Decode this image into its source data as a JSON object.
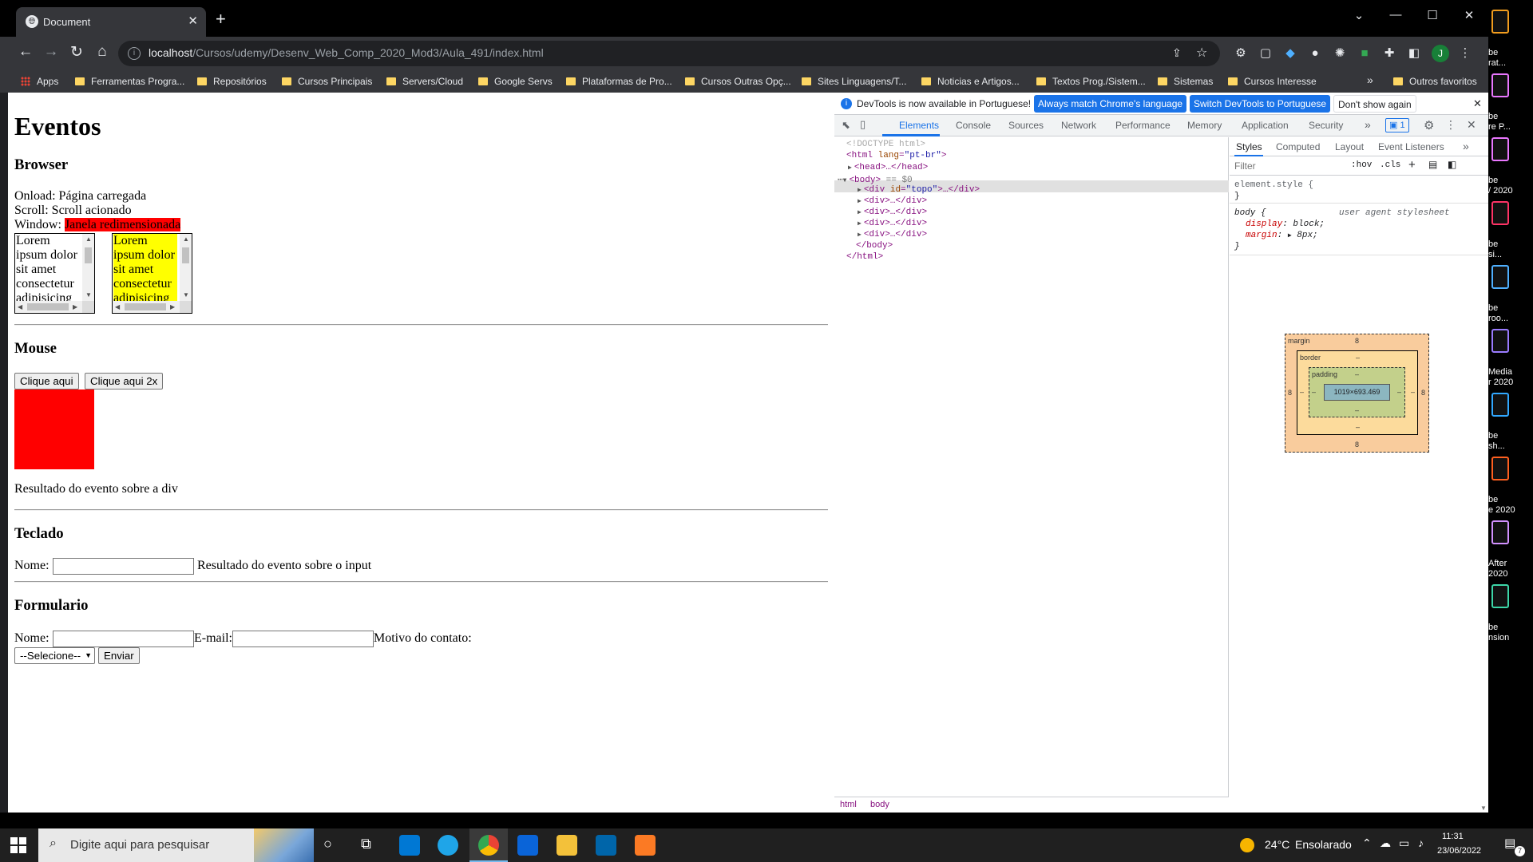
{
  "browser": {
    "tab_title": "Document",
    "url_host": "localhost",
    "url_path": "/Cursos/udemy/Desenv_Web_Comp_2020_Mod3/Aula_491/index.html",
    "profile_initial": "J",
    "bookmarks": [
      "Apps",
      "Ferramentas Progra...",
      "Repositórios",
      "Cursos Principais",
      "Servers/Cloud",
      "Google Servs",
      "Plataformas de Pro...",
      "Cursos Outras Opç...",
      "Sites Linguagens/T...",
      "Noticias e Artigos...",
      "Textos Prog./Sistem...",
      "Sistemas",
      "Cursos Interesse"
    ],
    "bookmarks_more": "»",
    "other_bookmarks": "Outros favoritos"
  },
  "page": {
    "title": "Eventos",
    "browser_heading": "Browser",
    "onload_label": "Onload: ",
    "onload_value": "Página carregada",
    "scroll_label": "Scroll: ",
    "scroll_value": "Scroll acionado",
    "window_label": "Window: ",
    "window_value": "Janela redimensionada",
    "box_text": "Lorem ipsum dolor sit amet consectetur adipisicing",
    "mouse_heading": "Mouse",
    "click_button": "Clique aqui",
    "dblclick_button": "Clique aqui 2x",
    "mouse_result": "Resultado do evento sobre a div",
    "keyboard_heading": "Teclado",
    "name_label": "Nome: ",
    "input_result": "Resultado do evento sobre o input",
    "form_heading": "Formulario",
    "form_name_label": "Nome: ",
    "form_email_label": "E-mail:",
    "form_reason_label": "Motivo do contato:",
    "select_value": "--Selecione--",
    "submit_button": "Enviar"
  },
  "devtools": {
    "info_message": "DevTools is now available in Portuguese!",
    "btn_match": "Always match Chrome's language",
    "btn_switch": "Switch DevTools to Portuguese",
    "btn_dont_show": "Don't show again",
    "tabs": [
      "Elements",
      "Console",
      "Sources",
      "Network",
      "Performance",
      "Memory",
      "Application",
      "Security"
    ],
    "tabs_more": "»",
    "issues_count": "1",
    "dom": {
      "doctype": "<!DOCTYPE html>",
      "html_open_tag": "<html ",
      "html_attr": "lang",
      "html_attr_val": "\"pt-br\"",
      "html_open_close": ">",
      "head": "<head>…</head>",
      "body_open": "<body>",
      "body_sel": " == $0",
      "div_topo_open": "<div ",
      "div_topo_attr": "id",
      "div_topo_val": "\"topo\"",
      "div_topo_close": ">…</div>",
      "div": "<div>…</div>",
      "body_close": "</body>",
      "html_close": "</html>"
    },
    "breadcrumbs": [
      "html",
      "body"
    ],
    "styles_tabs": [
      "Styles",
      "Computed",
      "Layout",
      "Event Listeners"
    ],
    "styles_more": "»",
    "filter_placeholder": "Filter",
    "hov": ":hov",
    "cls": ".cls",
    "element_style": "element.style {",
    "close_brace": "}",
    "body_rule": "body {",
    "ua_label": "user agent stylesheet",
    "decl_display_prop": "display",
    "decl_display_val": "block;",
    "decl_margin_prop": "margin",
    "decl_margin_val": "8px;",
    "box_model": {
      "margin_label": "margin",
      "border_label": "border",
      "padding_label": "padding",
      "margin_value": "8",
      "dash": "–",
      "content_size": "1019×693.469"
    }
  },
  "desktop_icons": [
    {
      "label": "be\nrat...",
      "color": "#f29d1e"
    },
    {
      "label": "be\nre P...",
      "color": "#ea77ff"
    },
    {
      "label": "be\n/ 2020",
      "color": "#ea77ff"
    },
    {
      "label": "be\nsi...",
      "color": "#ff3366"
    },
    {
      "label": "be\nroo...",
      "color": "#4fb0ff"
    },
    {
      "label": "Media\nr 2020",
      "color": "#9a7bff"
    },
    {
      "label": "be\nsh...",
      "color": "#31a8ff"
    },
    {
      "label": "be\ne 2020",
      "color": "#ff5f1f"
    },
    {
      "label": "After\n2020",
      "color": "#d291ff"
    },
    {
      "label": "be\nnsion",
      "color": "#3dd6a8"
    }
  ],
  "taskbar": {
    "search_placeholder": "Digite aqui para pesquisar",
    "weather_temp": "24°C",
    "weather_text": "Ensolarado",
    "time": "11:31",
    "date": "23/06/2022",
    "notifications": "7"
  },
  "colors": {
    "accent": "#1a73e8",
    "highlight_red": "#ff0000",
    "highlight_yellow": "#ffff00"
  }
}
